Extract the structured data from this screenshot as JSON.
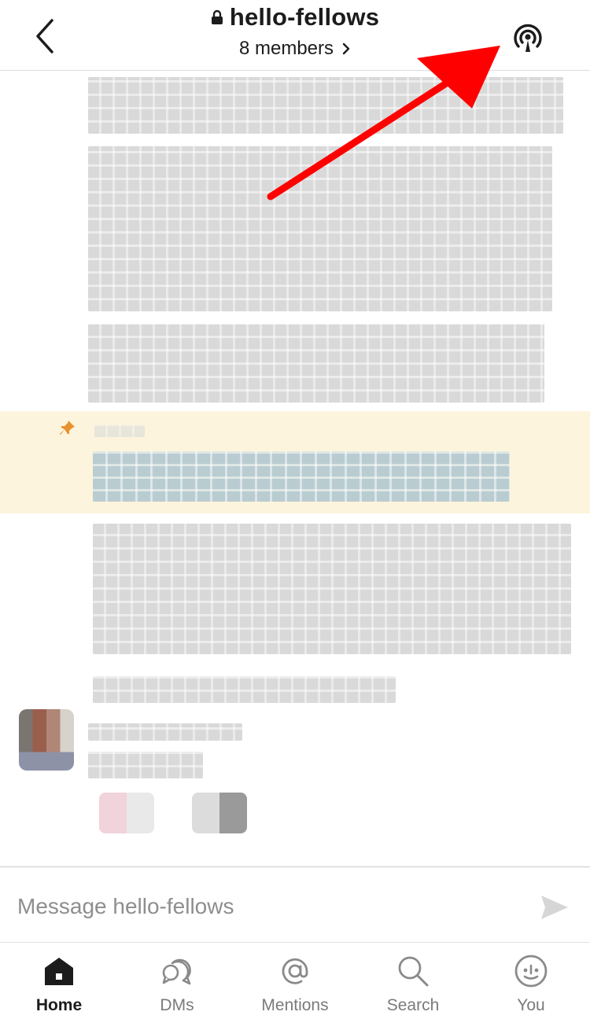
{
  "header": {
    "title": "hello-fellows",
    "members_label": "8 members",
    "back_icon": "chevron-left-icon",
    "lock_icon": "lock-icon",
    "huddle_icon": "headphones-huddle-icon"
  },
  "composer": {
    "placeholder": "Message hello-fellows",
    "value": "",
    "send_icon": "send-icon"
  },
  "tabs": [
    {
      "label": "Home",
      "icon": "home-icon",
      "active": true
    },
    {
      "label": "DMs",
      "icon": "dms-icon",
      "active": false
    },
    {
      "label": "Mentions",
      "icon": "at-mention-icon",
      "active": false
    },
    {
      "label": "Search",
      "icon": "search-icon",
      "active": false
    },
    {
      "label": "You",
      "icon": "you-smiley-icon",
      "active": false
    }
  ],
  "colors": {
    "pinned_background": "#fcf4dc",
    "pin_icon": "#e8912d",
    "annotation_arrow": "#ff0000",
    "active_tab": "#1d1c1d",
    "inactive_tab": "#7a7a7a"
  }
}
